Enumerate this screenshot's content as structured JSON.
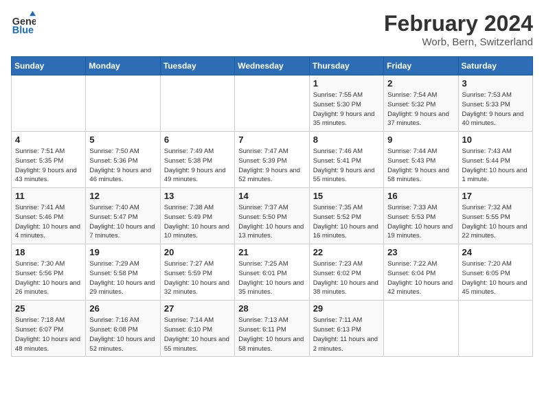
{
  "logo": {
    "general": "General",
    "blue": "Blue"
  },
  "title": "February 2024",
  "location": "Worb, Bern, Switzerland",
  "days_of_week": [
    "Sunday",
    "Monday",
    "Tuesday",
    "Wednesday",
    "Thursday",
    "Friday",
    "Saturday"
  ],
  "weeks": [
    [
      {
        "day": "",
        "sunrise": "",
        "sunset": "",
        "daylight": ""
      },
      {
        "day": "",
        "sunrise": "",
        "sunset": "",
        "daylight": ""
      },
      {
        "day": "",
        "sunrise": "",
        "sunset": "",
        "daylight": ""
      },
      {
        "day": "",
        "sunrise": "",
        "sunset": "",
        "daylight": ""
      },
      {
        "day": "1",
        "sunrise": "Sunrise: 7:55 AM",
        "sunset": "Sunset: 5:30 PM",
        "daylight": "Daylight: 9 hours and 35 minutes."
      },
      {
        "day": "2",
        "sunrise": "Sunrise: 7:54 AM",
        "sunset": "Sunset: 5:32 PM",
        "daylight": "Daylight: 9 hours and 37 minutes."
      },
      {
        "day": "3",
        "sunrise": "Sunrise: 7:53 AM",
        "sunset": "Sunset: 5:33 PM",
        "daylight": "Daylight: 9 hours and 40 minutes."
      }
    ],
    [
      {
        "day": "4",
        "sunrise": "Sunrise: 7:51 AM",
        "sunset": "Sunset: 5:35 PM",
        "daylight": "Daylight: 9 hours and 43 minutes."
      },
      {
        "day": "5",
        "sunrise": "Sunrise: 7:50 AM",
        "sunset": "Sunset: 5:36 PM",
        "daylight": "Daylight: 9 hours and 46 minutes."
      },
      {
        "day": "6",
        "sunrise": "Sunrise: 7:49 AM",
        "sunset": "Sunset: 5:38 PM",
        "daylight": "Daylight: 9 hours and 49 minutes."
      },
      {
        "day": "7",
        "sunrise": "Sunrise: 7:47 AM",
        "sunset": "Sunset: 5:39 PM",
        "daylight": "Daylight: 9 hours and 52 minutes."
      },
      {
        "day": "8",
        "sunrise": "Sunrise: 7:46 AM",
        "sunset": "Sunset: 5:41 PM",
        "daylight": "Daylight: 9 hours and 55 minutes."
      },
      {
        "day": "9",
        "sunrise": "Sunrise: 7:44 AM",
        "sunset": "Sunset: 5:43 PM",
        "daylight": "Daylight: 9 hours and 58 minutes."
      },
      {
        "day": "10",
        "sunrise": "Sunrise: 7:43 AM",
        "sunset": "Sunset: 5:44 PM",
        "daylight": "Daylight: 10 hours and 1 minute."
      }
    ],
    [
      {
        "day": "11",
        "sunrise": "Sunrise: 7:41 AM",
        "sunset": "Sunset: 5:46 PM",
        "daylight": "Daylight: 10 hours and 4 minutes."
      },
      {
        "day": "12",
        "sunrise": "Sunrise: 7:40 AM",
        "sunset": "Sunset: 5:47 PM",
        "daylight": "Daylight: 10 hours and 7 minutes."
      },
      {
        "day": "13",
        "sunrise": "Sunrise: 7:38 AM",
        "sunset": "Sunset: 5:49 PM",
        "daylight": "Daylight: 10 hours and 10 minutes."
      },
      {
        "day": "14",
        "sunrise": "Sunrise: 7:37 AM",
        "sunset": "Sunset: 5:50 PM",
        "daylight": "Daylight: 10 hours and 13 minutes."
      },
      {
        "day": "15",
        "sunrise": "Sunrise: 7:35 AM",
        "sunset": "Sunset: 5:52 PM",
        "daylight": "Daylight: 10 hours and 16 minutes."
      },
      {
        "day": "16",
        "sunrise": "Sunrise: 7:33 AM",
        "sunset": "Sunset: 5:53 PM",
        "daylight": "Daylight: 10 hours and 19 minutes."
      },
      {
        "day": "17",
        "sunrise": "Sunrise: 7:32 AM",
        "sunset": "Sunset: 5:55 PM",
        "daylight": "Daylight: 10 hours and 22 minutes."
      }
    ],
    [
      {
        "day": "18",
        "sunrise": "Sunrise: 7:30 AM",
        "sunset": "Sunset: 5:56 PM",
        "daylight": "Daylight: 10 hours and 26 minutes."
      },
      {
        "day": "19",
        "sunrise": "Sunrise: 7:29 AM",
        "sunset": "Sunset: 5:58 PM",
        "daylight": "Daylight: 10 hours and 29 minutes."
      },
      {
        "day": "20",
        "sunrise": "Sunrise: 7:27 AM",
        "sunset": "Sunset: 5:59 PM",
        "daylight": "Daylight: 10 hours and 32 minutes."
      },
      {
        "day": "21",
        "sunrise": "Sunrise: 7:25 AM",
        "sunset": "Sunset: 6:01 PM",
        "daylight": "Daylight: 10 hours and 35 minutes."
      },
      {
        "day": "22",
        "sunrise": "Sunrise: 7:23 AM",
        "sunset": "Sunset: 6:02 PM",
        "daylight": "Daylight: 10 hours and 38 minutes."
      },
      {
        "day": "23",
        "sunrise": "Sunrise: 7:22 AM",
        "sunset": "Sunset: 6:04 PM",
        "daylight": "Daylight: 10 hours and 42 minutes."
      },
      {
        "day": "24",
        "sunrise": "Sunrise: 7:20 AM",
        "sunset": "Sunset: 6:05 PM",
        "daylight": "Daylight: 10 hours and 45 minutes."
      }
    ],
    [
      {
        "day": "25",
        "sunrise": "Sunrise: 7:18 AM",
        "sunset": "Sunset: 6:07 PM",
        "daylight": "Daylight: 10 hours and 48 minutes."
      },
      {
        "day": "26",
        "sunrise": "Sunrise: 7:16 AM",
        "sunset": "Sunset: 6:08 PM",
        "daylight": "Daylight: 10 hours and 52 minutes."
      },
      {
        "day": "27",
        "sunrise": "Sunrise: 7:14 AM",
        "sunset": "Sunset: 6:10 PM",
        "daylight": "Daylight: 10 hours and 55 minutes."
      },
      {
        "day": "28",
        "sunrise": "Sunrise: 7:13 AM",
        "sunset": "Sunset: 6:11 PM",
        "daylight": "Daylight: 10 hours and 58 minutes."
      },
      {
        "day": "29",
        "sunrise": "Sunrise: 7:11 AM",
        "sunset": "Sunset: 6:13 PM",
        "daylight": "Daylight: 11 hours and 2 minutes."
      },
      {
        "day": "",
        "sunrise": "",
        "sunset": "",
        "daylight": ""
      },
      {
        "day": "",
        "sunrise": "",
        "sunset": "",
        "daylight": ""
      }
    ]
  ]
}
